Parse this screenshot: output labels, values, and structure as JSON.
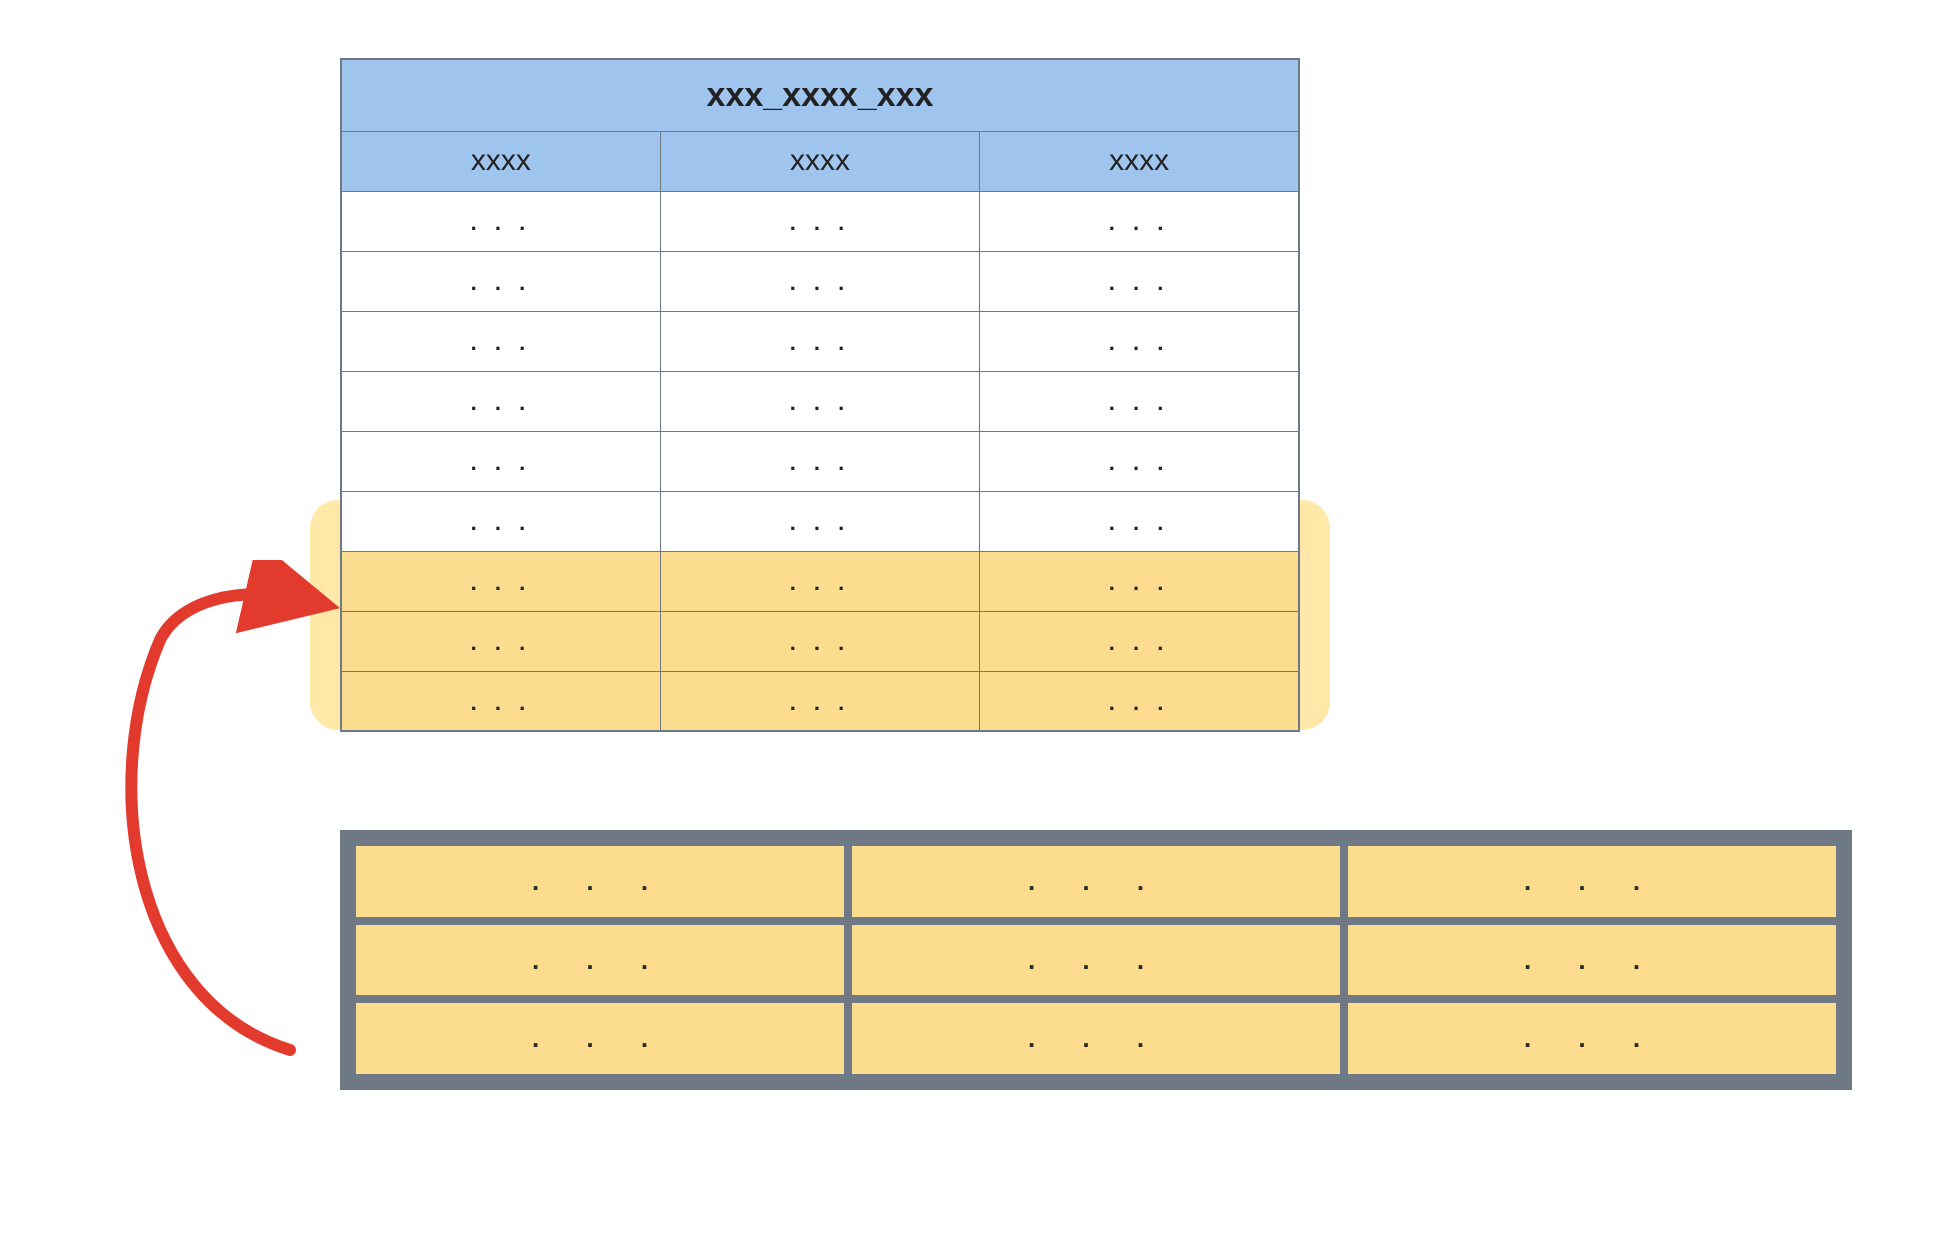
{
  "diagram": {
    "top_table": {
      "title": "xxx_xxxx_xxx",
      "columns": [
        "xxxx",
        "xxxx",
        "xxxx"
      ],
      "rows": [
        {
          "cells": [
            ". . .",
            ". . .",
            ". . ."
          ],
          "highlighted": false
        },
        {
          "cells": [
            ". . .",
            ". . .",
            ". . ."
          ],
          "highlighted": false
        },
        {
          "cells": [
            ". . .",
            ". . .",
            ". . ."
          ],
          "highlighted": false
        },
        {
          "cells": [
            ". . .",
            ". . .",
            ". . ."
          ],
          "highlighted": false
        },
        {
          "cells": [
            ". . .",
            ". . .",
            ". . ."
          ],
          "highlighted": false
        },
        {
          "cells": [
            ". . .",
            ". . .",
            ". . ."
          ],
          "highlighted": false
        },
        {
          "cells": [
            ". . .",
            ". . .",
            ". . ."
          ],
          "highlighted": true
        },
        {
          "cells": [
            ". . .",
            ". . .",
            ". . ."
          ],
          "highlighted": true
        },
        {
          "cells": [
            ". . .",
            ". . .",
            ". . ."
          ],
          "highlighted": true
        }
      ]
    },
    "bottom_block": {
      "rows": [
        [
          ". . .",
          ". . .",
          ". . ."
        ],
        [
          ". . .",
          ". . .",
          ". . ."
        ],
        [
          ". . .",
          ". . .",
          ". . ."
        ]
      ]
    },
    "colors": {
      "header_bg": "#9fc4ee",
      "highlight_bg": "#fcdc8e",
      "halo_bg": "#ffe8a8",
      "border": "#6f7985",
      "arrow": "#e23b2e"
    }
  }
}
